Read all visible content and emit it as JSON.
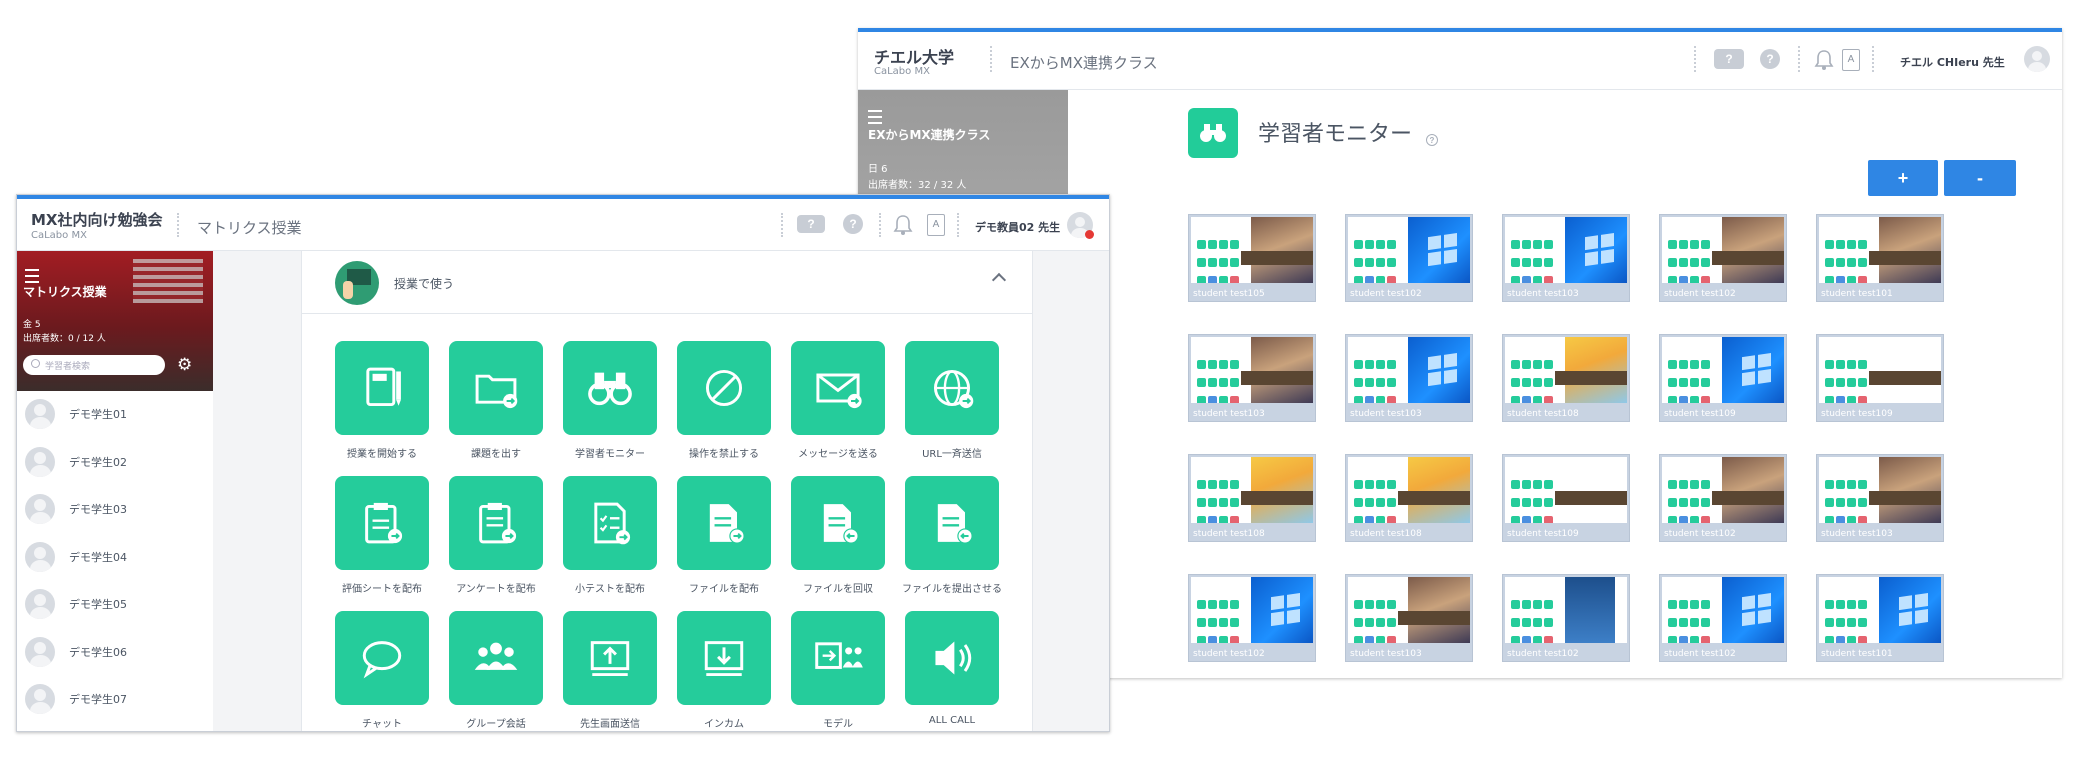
{
  "back_window": {
    "org_name": "チエル大学",
    "org_sub": "CaLabo MX",
    "class_name": "EXからMX連携クラス",
    "help_label": "?",
    "info_label": "?",
    "a_label": "A",
    "teacher": "チエル CHIeru 先生",
    "sidebar": {
      "class_name": "EXからMX連携クラス",
      "day": "日 6",
      "attendance": "出席者数：32 / 32 人"
    },
    "page_title": "学習者モニター",
    "title_help": "?",
    "zoom_in_label": "+",
    "zoom_out_label": "-",
    "thumbnails": [
      {
        "name": "student test105",
        "style": "photo"
      },
      {
        "name": "student test102",
        "style": "windows"
      },
      {
        "name": "student test103",
        "style": "windows"
      },
      {
        "name": "student test102",
        "style": "photo"
      },
      {
        "name": "student test101",
        "style": "photo"
      },
      {
        "name": "student test103",
        "style": "photo"
      },
      {
        "name": "student test103",
        "style": "windows"
      },
      {
        "name": "student test108",
        "style": "yellow"
      },
      {
        "name": "student test109",
        "style": "windows"
      },
      {
        "name": "student test109",
        "style": "brown"
      },
      {
        "name": "student test108",
        "style": "yellow"
      },
      {
        "name": "student test108",
        "style": "yellow"
      },
      {
        "name": "student test109",
        "style": "brown"
      },
      {
        "name": "student test102",
        "style": "photo"
      },
      {
        "name": "student test103",
        "style": "photo"
      },
      {
        "name": "student test102",
        "style": "windows"
      },
      {
        "name": "student test103",
        "style": "photo"
      },
      {
        "name": "student test102",
        "style": "blue"
      },
      {
        "name": "student test102",
        "style": "windows"
      },
      {
        "name": "student test101",
        "style": "windows"
      }
    ]
  },
  "front_window": {
    "org_name": "MX社内向け勉強会",
    "org_sub": "CaLabo MX",
    "class_name": "マトリクス授業",
    "help_label": "?",
    "info_label": "?",
    "a_label": "A",
    "teacher": "デモ教員02 先生",
    "sidebar": {
      "class_name": "マトリクス授業",
      "day": "金 5",
      "attendance": "出席者数：0 / 12 人",
      "search_placeholder": "学習者検索"
    },
    "students": [
      "デモ学生01",
      "デモ学生02",
      "デモ学生03",
      "デモ学生04",
      "デモ学生05",
      "デモ学生06",
      "デモ学生07"
    ],
    "panel_title": "授業で使う",
    "tiles": [
      {
        "label": "授業を開始する",
        "icon": "notebook-icon"
      },
      {
        "label": "課題を出す",
        "icon": "folder-icon"
      },
      {
        "label": "学習者モニター",
        "icon": "binoculars-icon"
      },
      {
        "label": "操作を禁止する",
        "icon": "prohibit-icon"
      },
      {
        "label": "メッセージを送る",
        "icon": "envelope-icon"
      },
      {
        "label": "URL一斉送信",
        "icon": "globe-icon"
      },
      {
        "label": "評価シートを配布",
        "icon": "clipboard-icon"
      },
      {
        "label": "アンケートを配布",
        "icon": "survey-icon"
      },
      {
        "label": "小テストを配布",
        "icon": "quiz-icon"
      },
      {
        "label": "ファイルを配布",
        "icon": "file-send-icon"
      },
      {
        "label": "ファイルを回収",
        "icon": "file-collect-icon"
      },
      {
        "label": "ファイルを提出させる",
        "icon": "file-submit-icon"
      },
      {
        "label": "チャット",
        "icon": "chat-icon"
      },
      {
        "label": "グループ会話",
        "icon": "group-icon"
      },
      {
        "label": "先生画面送信",
        "icon": "screen-send-icon"
      },
      {
        "label": "インカム",
        "icon": "screen-receive-icon"
      },
      {
        "label": "モデル",
        "icon": "model-icon"
      },
      {
        "label": "ALL CALL",
        "icon": "speaker-icon"
      }
    ]
  },
  "colors": {
    "accent_blue": "#2f86e4",
    "tile_green": "#25cc9b",
    "notify_red": "#e53935"
  }
}
